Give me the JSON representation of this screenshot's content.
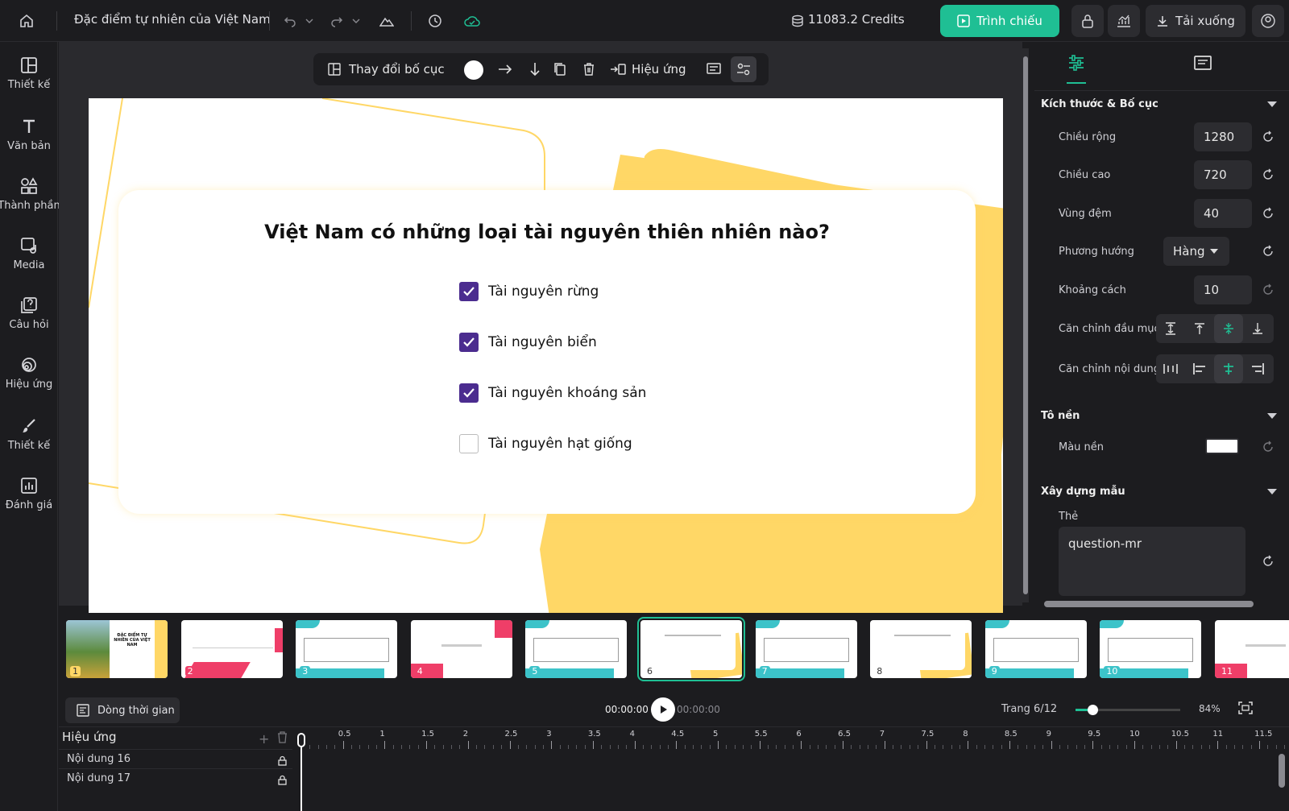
{
  "topbar": {
    "doc_title": "Đặc điểm tự nhiên của Việt Nam",
    "credits": "11083.2 Credits",
    "present_label": "Trình chiếu",
    "download_label": "Tải xuống"
  },
  "left_nav": [
    {
      "label": "Thiết kế",
      "icon": "layout-icon"
    },
    {
      "label": "Văn bản",
      "icon": "text-icon"
    },
    {
      "label": "Thành phần",
      "icon": "components-icon"
    },
    {
      "label": "Media",
      "icon": "media-icon"
    },
    {
      "label": "Câu hỏi",
      "icon": "question-icon"
    },
    {
      "label": "Hiệu ứng",
      "icon": "effects-icon"
    },
    {
      "label": "Thiết kế",
      "icon": "brush-icon"
    },
    {
      "label": "Đánh giá",
      "icon": "chart-icon"
    }
  ],
  "floating_toolbar": {
    "change_layout": "Thay đổi bố cục",
    "effects": "Hiệu ứng"
  },
  "slide": {
    "question": "Việt Nam có những loại tài nguyên thiên nhiên nào?",
    "options": [
      {
        "text": "Tài nguyên rừng",
        "checked": true
      },
      {
        "text": "Tài nguyên biển",
        "checked": true
      },
      {
        "text": "Tài nguyên khoáng sản",
        "checked": true
      },
      {
        "text": "Tài nguyên hạt giống",
        "checked": false
      }
    ]
  },
  "right_panel": {
    "size_section": "Kích thước & Bố cục",
    "width_label": "Chiều rộng",
    "width_value": "1280",
    "height_label": "Chiều cao",
    "height_value": "720",
    "padding_label": "Vùng đệm",
    "padding_value": "40",
    "direction_label": "Phương hướng",
    "direction_value": "Hàng",
    "gap_label": "Khoảng cách",
    "gap_value": "10",
    "align_items_label": "Căn chỉnh đầu mục",
    "justify_label": "Căn chỉnh nội dung",
    "bg_section": "Tô nền",
    "bg_color_label": "Màu nền",
    "bg_color_value": "#ffffff",
    "build_section": "Xây dựng mẫu",
    "tag_label": "Thẻ",
    "tag_value": "question-mr"
  },
  "thumbnails": [
    "1",
    "2",
    "3",
    "4",
    "5",
    "6",
    "7",
    "8",
    "9",
    "10",
    "11"
  ],
  "thumbnail_title_1": "ĐẶC ĐIỂM TỰ NHIÊN CỦA VIỆT NAM",
  "timeline": {
    "button_label": "Dòng thời gian",
    "current_time": "00:00:00",
    "total_time": "00:00:00",
    "page": "Trang 6/12",
    "zoom": "84%",
    "zoom_fraction": 0.16,
    "effects_header": "Hiệu ứng",
    "tracks": [
      "Nội dung 16",
      "Nội dung 17"
    ],
    "ruler": [
      "0",
      "0.5",
      "1",
      "1.5",
      "2",
      "2.5",
      "3",
      "3.5",
      "4",
      "4.5",
      "5",
      "5.5",
      "6",
      "6.5",
      "7",
      "7.5",
      "8",
      "8.5",
      "9",
      "9.5",
      "10",
      "10.5",
      "11",
      "11.5"
    ]
  },
  "colors": {
    "accent": "#1fbf94",
    "checkbox": "#4b2c8f",
    "slide_yellow": "#ffd766"
  }
}
